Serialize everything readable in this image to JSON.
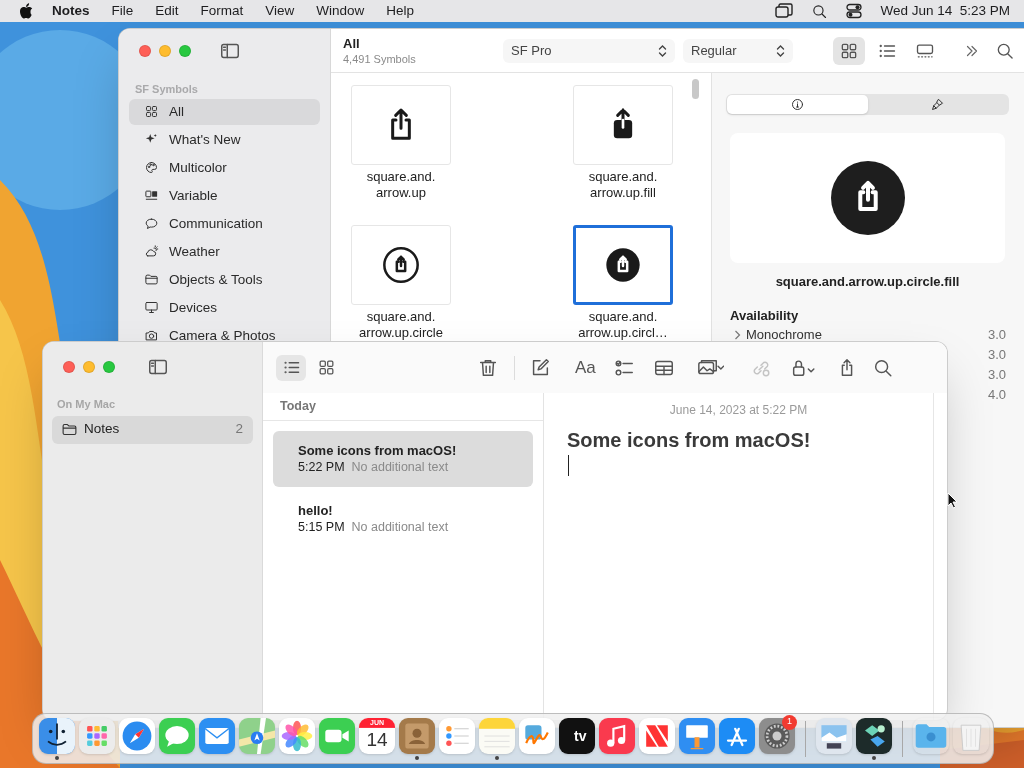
{
  "menu_bar": {
    "app_name": "Notes",
    "menus": [
      "File",
      "Edit",
      "Format",
      "View",
      "Window",
      "Help"
    ],
    "clock": "Wed Jun 14  5:23 PM"
  },
  "sf_symbols_window": {
    "header": {
      "title": "All",
      "subtitle": "4,491 Symbols"
    },
    "font_menu": "SF Pro",
    "weight_menu": "Regular",
    "view_modes": [
      {
        "kind": "grid",
        "selected": true
      },
      {
        "kind": "list",
        "selected": false
      },
      {
        "kind": "gallery",
        "selected": false
      }
    ],
    "sidebar": {
      "section": "SF Symbols",
      "items": [
        {
          "kind": "all",
          "label": "All",
          "selected": true
        },
        {
          "kind": "sparkles",
          "label": "What's New",
          "selected": false
        },
        {
          "kind": "palette",
          "label": "Multicolor",
          "selected": false
        },
        {
          "kind": "variable",
          "label": "Variable",
          "selected": false
        },
        {
          "kind": "bubble",
          "label": "Communication",
          "selected": false
        },
        {
          "kind": "weather",
          "label": "Weather",
          "selected": false
        },
        {
          "kind": "folder",
          "label": "Objects & Tools",
          "selected": false
        },
        {
          "kind": "display",
          "label": "Devices",
          "selected": false
        },
        {
          "kind": "camera",
          "label": "Camera & Photos",
          "selected": false
        }
      ]
    },
    "symbols": [
      {
        "kind": "outline",
        "name_lines": [
          "square.and.",
          "arrow.up"
        ],
        "selected": false
      },
      {
        "kind": "fill",
        "name_lines": [
          "square.and.",
          "arrow.up.fill"
        ],
        "selected": false
      },
      {
        "kind": "circle",
        "name_lines": [
          "square.and.",
          "arrow.up.circle"
        ],
        "selected": false
      },
      {
        "kind": "circle_fill",
        "name_lines": [
          "square.and.",
          "arrow.up.circl…"
        ],
        "selected": true
      }
    ],
    "inspector": {
      "tabs": [
        {
          "kind": "info",
          "selected": true
        },
        {
          "kind": "brush",
          "selected": false
        }
      ],
      "symbol_name": "square.and.arrow.up.circle.fill",
      "section_title": "Availability",
      "rows": [
        {
          "label": "Monochrome",
          "version": "3.0"
        },
        {
          "version": "3.0"
        },
        {
          "version": "3.0"
        },
        {
          "version": "4.0"
        }
      ]
    }
  },
  "notes_window": {
    "sidebar": {
      "section": "On My Mac",
      "folders": [
        {
          "label": "Notes",
          "count": "2",
          "selected": true
        }
      ]
    },
    "view_modes": [
      {
        "kind": "list",
        "selected": true
      },
      {
        "kind": "gallery",
        "selected": false
      }
    ],
    "toolbar": [
      {
        "kind": "delete",
        "disabled": false
      },
      {
        "kind": "compose",
        "disabled": false
      },
      {
        "kind": "format",
        "label": "Aa",
        "disabled": false
      },
      {
        "kind": "checklist",
        "disabled": false
      },
      {
        "kind": "table",
        "disabled": false
      },
      {
        "kind": "media",
        "disabled": false
      },
      {
        "kind": "link",
        "disabled": true
      },
      {
        "kind": "lock",
        "disabled": false
      },
      {
        "kind": "share",
        "disabled": false
      },
      {
        "kind": "search",
        "disabled": false
      }
    ],
    "list_header": "Today",
    "notes": [
      {
        "title": "Some icons from macOS!",
        "time": "5:22 PM",
        "preview": "No additional text",
        "selected": true
      },
      {
        "title": "hello!",
        "time": "5:15 PM",
        "preview": "No additional text",
        "selected": false
      }
    ],
    "editor": {
      "date": "June 14, 2023 at 5:22 PM",
      "title": "Some icons from macOS!"
    }
  },
  "dock": {
    "sections": [
      {
        "apps": [
          {
            "kind": "finder",
            "running": true
          },
          {
            "kind": "launchpad",
            "running": false
          },
          {
            "kind": "safari",
            "running": false
          },
          {
            "kind": "messages",
            "running": false
          },
          {
            "kind": "mail",
            "running": false
          },
          {
            "kind": "maps",
            "running": false
          },
          {
            "kind": "photos",
            "running": false
          },
          {
            "kind": "facetime",
            "running": false
          },
          {
            "kind": "calendar",
            "running": false,
            "month": "JUN",
            "day": "14"
          },
          {
            "kind": "contacts",
            "running": true
          },
          {
            "kind": "reminders",
            "running": false
          },
          {
            "kind": "notes",
            "running": true
          },
          {
            "kind": "freeform",
            "running": false
          },
          {
            "kind": "tv",
            "running": false,
            "label": "tv"
          },
          {
            "kind": "music",
            "running": false
          },
          {
            "kind": "news",
            "running": false
          },
          {
            "kind": "keynote",
            "running": false
          },
          {
            "kind": "appstore",
            "running": false
          },
          {
            "kind": "settings",
            "running": false,
            "badge": "1"
          }
        ]
      },
      {
        "apps": [
          {
            "kind": "preview",
            "running": false
          },
          {
            "kind": "utility",
            "running": true
          }
        ]
      },
      {
        "apps": [
          {
            "kind": "downloads",
            "running": false
          },
          {
            "kind": "trash",
            "running": false
          }
        ]
      }
    ]
  }
}
